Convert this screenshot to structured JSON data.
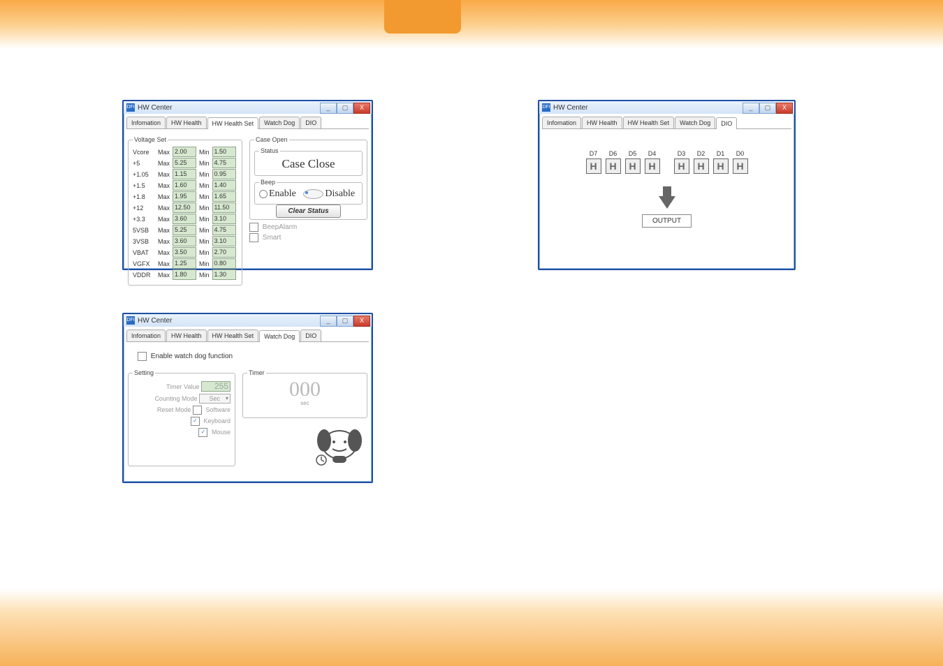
{
  "window_title": "HW Center",
  "window_icon_text": "DFI",
  "tabs": [
    "Infomation",
    "HW Health",
    "HW Health Set",
    "Watch Dog",
    "DIO"
  ],
  "win_min": "_",
  "win_max": "▢",
  "win_close": "X",
  "hw_set": {
    "voltage_set_legend": "Voltage Set",
    "max_label": "Max",
    "min_label": "Min",
    "rows": [
      {
        "name": "Vcore",
        "max": "2.00",
        "min": "1.50"
      },
      {
        "name": "+5",
        "max": "5.25",
        "min": "4.75"
      },
      {
        "name": "+1.05",
        "max": "1.15",
        "min": "0.95"
      },
      {
        "name": "+1.5",
        "max": "1.60",
        "min": "1.40"
      },
      {
        "name": "+1.8",
        "max": "1.95",
        "min": "1.65"
      },
      {
        "name": "+12",
        "max": "12.50",
        "min": "11.50"
      },
      {
        "name": "+3.3",
        "max": "3.60",
        "min": "3.10"
      },
      {
        "name": "5VSB",
        "max": "5.25",
        "min": "4.75"
      },
      {
        "name": "3VSB",
        "max": "3.60",
        "min": "3.10"
      },
      {
        "name": "VBAT",
        "max": "3.50",
        "min": "2.70"
      },
      {
        "name": "VGFX",
        "max": "1.25",
        "min": "0.80"
      },
      {
        "name": "VDDR",
        "max": "1.80",
        "min": "1.30"
      }
    ],
    "case_open_legend": "Case Open",
    "status_legend": "Status",
    "status_text": "Case Close",
    "beep_legend": "Beep",
    "enable_label": "Enable",
    "disable_label": "Disable",
    "clear_status": "Clear Status",
    "beep_alarm": "BeepAlarm",
    "smart": "Smart"
  },
  "watchdog": {
    "enable_label": "Enable watch dog function",
    "setting_legend": "Setting",
    "timer_value_label": "Timer Value",
    "timer_value": "255",
    "counting_mode_label": "Counting Mode",
    "counting_mode_value": "Sec",
    "reset_mode_label": "Reset Mode",
    "software_label": "Software",
    "keyboard_label": "Keyboard",
    "mouse_label": "Mouse",
    "timer_legend": "Timer",
    "timer_display": "000",
    "timer_unit": "sec"
  },
  "dio": {
    "labels": [
      "D7",
      "D6",
      "D5",
      "D4",
      "D3",
      "D2",
      "D1",
      "D0"
    ],
    "box_text": "H",
    "output_label": "OUTPUT"
  }
}
